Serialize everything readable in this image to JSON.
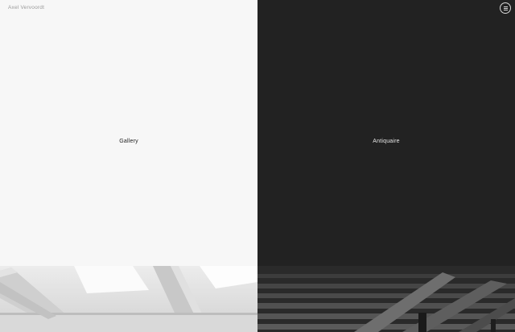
{
  "header": {
    "brand": "Axel Vervoordt",
    "menu_icon": "hamburger-menu-icon"
  },
  "panels": [
    {
      "label": "Gallery",
      "background": "#f7f7f7",
      "text_color": "#1e1e1e"
    },
    {
      "label": "Antiquaire",
      "background": "#222222",
      "text_color": "#e6e6e6"
    }
  ],
  "photos": {
    "gallery": "white gallery ceiling with skylights",
    "antiquaire": "dark wooden beamed ceiling"
  }
}
